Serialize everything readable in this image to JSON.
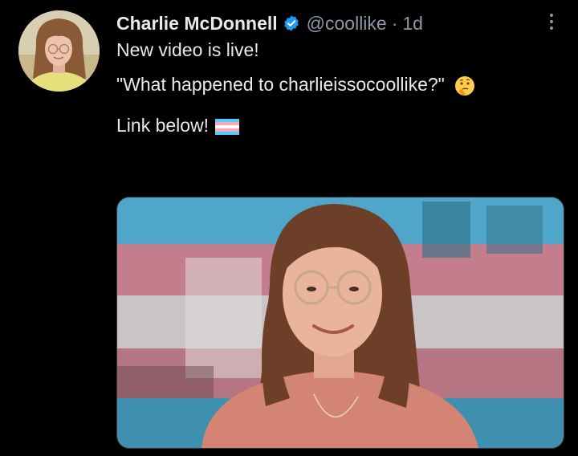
{
  "tweet": {
    "display_name": "Charlie McDonnell",
    "handle": "@coollike",
    "separator": "·",
    "timestamp": "1d",
    "text_line1": "New video is live!",
    "text_line2": "\"What happened to charlieissocoollike?\"",
    "text_line3": "Link below!",
    "emoji_thinking": "thinking-face-emoji",
    "emoji_flag": "transgender-flag-emoji"
  },
  "icons": {
    "verified": "verified-badge-icon",
    "more": "more-options-icon"
  },
  "colors": {
    "background": "#000000",
    "text_primary": "#e7e9ea",
    "text_secondary": "#8b98a5",
    "verified_blue": "#1d9bf0",
    "flag_blue": "#55cdfc",
    "flag_pink": "#f7a8b8",
    "flag_white": "#ffffff"
  }
}
